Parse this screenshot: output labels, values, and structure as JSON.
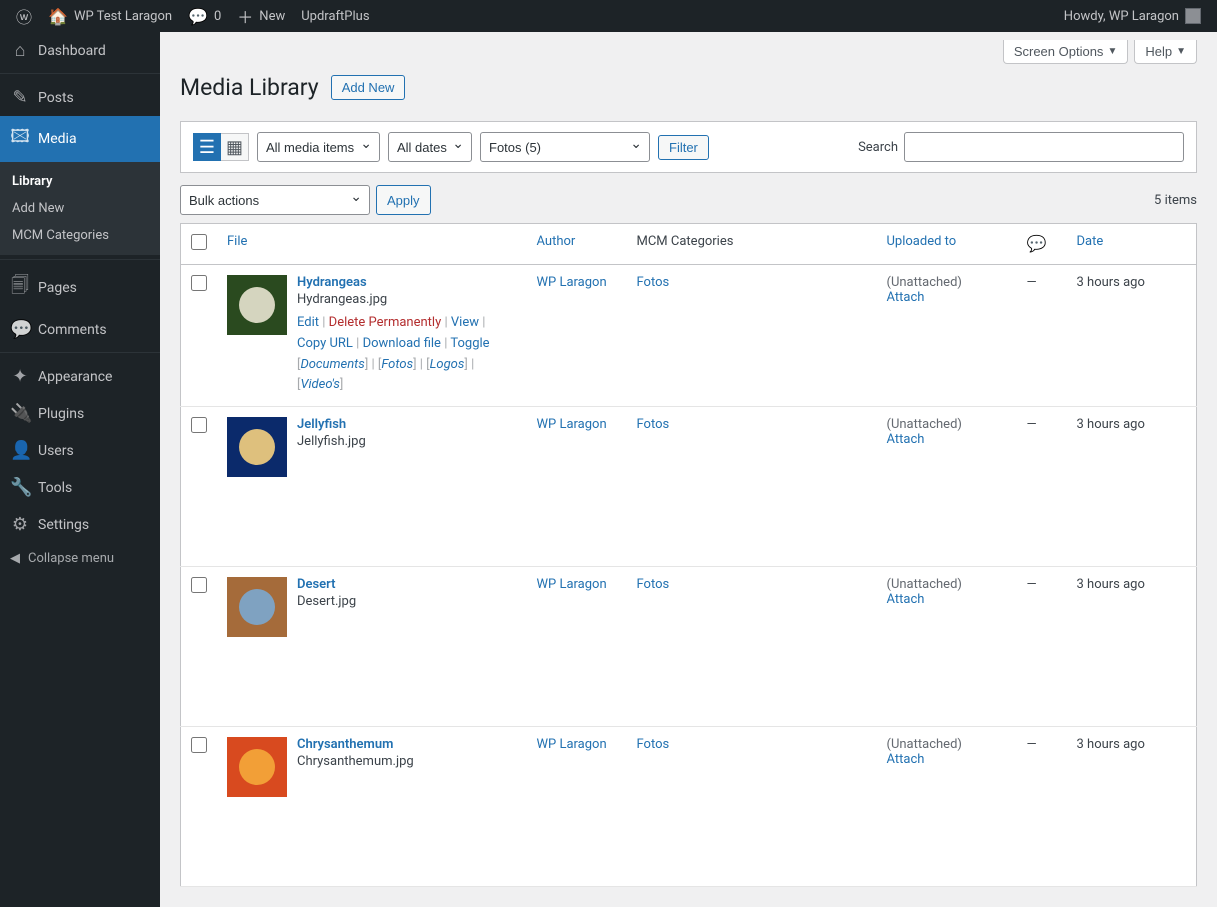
{
  "adminbar": {
    "site_name": "WP Test Laragon",
    "comments_count": "0",
    "new_label": "New",
    "updraft": "UpdraftPlus",
    "howdy": "Howdy, WP Laragon"
  },
  "sidebar": {
    "items": [
      {
        "label": "Dashboard",
        "icon": "⌂"
      },
      {
        "label": "Posts",
        "icon": "✎"
      },
      {
        "label": "Media",
        "icon": "🖾",
        "current": true
      },
      {
        "label": "Pages",
        "icon": "🗐"
      },
      {
        "label": "Comments",
        "icon": "💬"
      },
      {
        "label": "Appearance",
        "icon": "✦"
      },
      {
        "label": "Plugins",
        "icon": "🔌"
      },
      {
        "label": "Users",
        "icon": "👤"
      },
      {
        "label": "Tools",
        "icon": "🔧"
      },
      {
        "label": "Settings",
        "icon": "⚙"
      }
    ],
    "media_submenu": [
      "Library",
      "Add New",
      "MCM Categories"
    ],
    "collapse": "Collapse menu"
  },
  "screen": {
    "options": "Screen Options",
    "help": "Help"
  },
  "page": {
    "title": "Media Library",
    "add_new": "Add New"
  },
  "filters": {
    "media_type": "All media items",
    "dates": "All dates",
    "category": "Fotos  (5)",
    "filter_btn": "Filter",
    "search_label": "Search"
  },
  "bulk": {
    "label": "Bulk actions",
    "apply": "Apply"
  },
  "count_label": "5 items",
  "columns": {
    "file": "File",
    "author": "Author",
    "mcm": "MCM Categories",
    "uploaded": "Uploaded to",
    "date": "Date"
  },
  "row_actions": {
    "edit": "Edit",
    "delete": "Delete Permanently",
    "view": "View",
    "copy": "Copy URL",
    "download": "Download file",
    "toggle": "Toggle",
    "cats": [
      "Documents",
      "Fotos",
      "Logos",
      "Video's"
    ]
  },
  "unattached": "(Unattached)",
  "attach": "Attach",
  "dash": "—",
  "rows": [
    {
      "title": "Hydrangeas",
      "filename": "Hydrangeas.jpg",
      "author": "WP Laragon",
      "mcm": "Fotos",
      "date": "3 hours ago",
      "expanded": true,
      "thumb": {
        "bg": "#2a4a1f",
        "fg": "#e8e4d0"
      }
    },
    {
      "title": "Jellyfish",
      "filename": "Jellyfish.jpg",
      "author": "WP Laragon",
      "mcm": "Fotos",
      "date": "3 hours ago",
      "thumb": {
        "bg": "#0b2a6b",
        "fg": "#f5d080"
      }
    },
    {
      "title": "Desert",
      "filename": "Desert.jpg",
      "author": "WP Laragon",
      "mcm": "Fotos",
      "date": "3 hours ago",
      "thumb": {
        "bg": "#a56b3a",
        "fg": "#7ba8d0"
      }
    },
    {
      "title": "Chrysanthemum",
      "filename": "Chrysanthemum.jpg",
      "author": "WP Laragon",
      "mcm": "Fotos",
      "date": "3 hours ago",
      "thumb": {
        "bg": "#d84a1f",
        "fg": "#f5a83a"
      }
    }
  ]
}
